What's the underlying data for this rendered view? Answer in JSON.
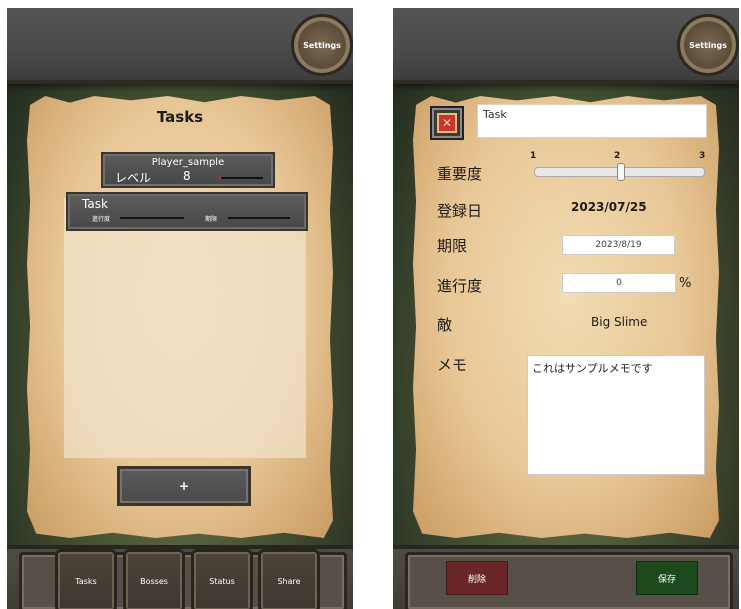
{
  "list_screen": {
    "settings_label": "Settings",
    "title": "Tasks",
    "player": {
      "name": "Player_sample",
      "level_label": "レベル",
      "level_value": "8",
      "exp_progress": 0.05
    },
    "tasks": [
      {
        "name": "Task",
        "progress_label": "進行度",
        "deadline_label": "期限"
      }
    ],
    "add_label": "+",
    "nav": [
      "Tasks",
      "Bosses",
      "Status",
      "Share"
    ]
  },
  "edit_screen": {
    "settings_label": "Settings",
    "close_icon": "close-icon",
    "task_name": "Task",
    "labels": {
      "importance": "重要度",
      "registered": "登録日",
      "deadline": "期限",
      "progress": "進行度",
      "enemy": "敵",
      "memo": "メモ"
    },
    "importance": {
      "ticks": [
        "1",
        "2",
        "3"
      ],
      "value": 2
    },
    "registered_date": "2023/07/25",
    "deadline_value": "2023/8/19",
    "progress_value": "0",
    "progress_unit": "%",
    "enemy_value": "Big Slime",
    "memo_value": "これはサンプルメモです",
    "delete_label": "削除",
    "save_label": "保存"
  }
}
